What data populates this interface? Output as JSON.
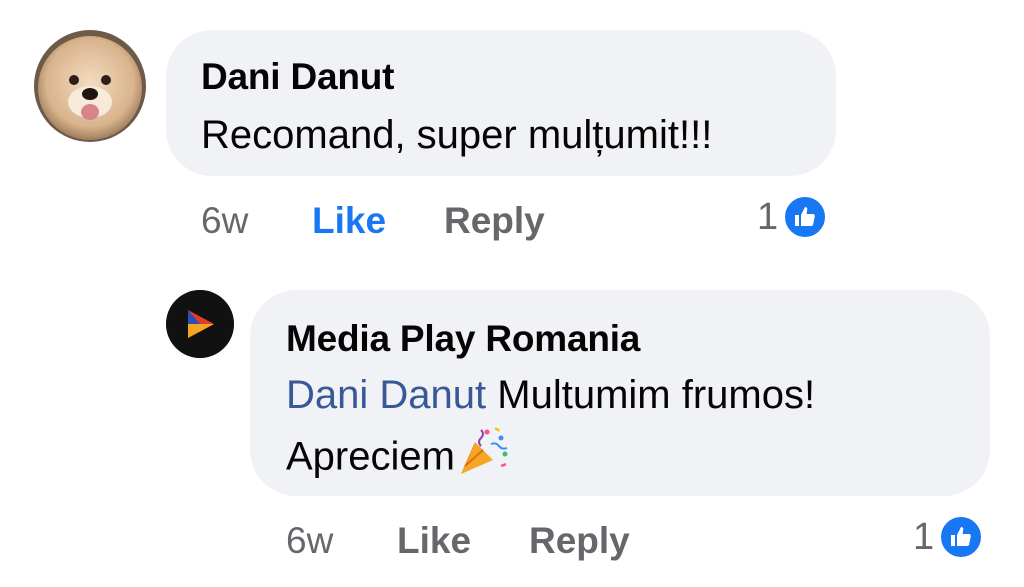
{
  "comments": [
    {
      "author": "Dani Danut",
      "text": "Recomand, super mulțumit!!!",
      "time": "6w",
      "like_label": "Like",
      "reply_label": "Reply",
      "reaction_count": "1",
      "liked_by_viewer": true,
      "avatar_icon": "dog-photo-avatar"
    },
    {
      "author": "Media Play Romania",
      "mention": "Dani Danut",
      "text_line1": "Multumim frumos!",
      "text_line2": "Apreciem",
      "emoji_icon": "party-popper-icon",
      "time": "6w",
      "like_label": "Like",
      "reply_label": "Reply",
      "reaction_count": "1",
      "liked_by_viewer": false,
      "avatar_icon": "media-play-logo"
    }
  ],
  "colors": {
    "bubble": "#f0f2f5",
    "link_blue": "#1877f2",
    "mention_blue": "#385898",
    "meta_gray": "#65676b"
  }
}
